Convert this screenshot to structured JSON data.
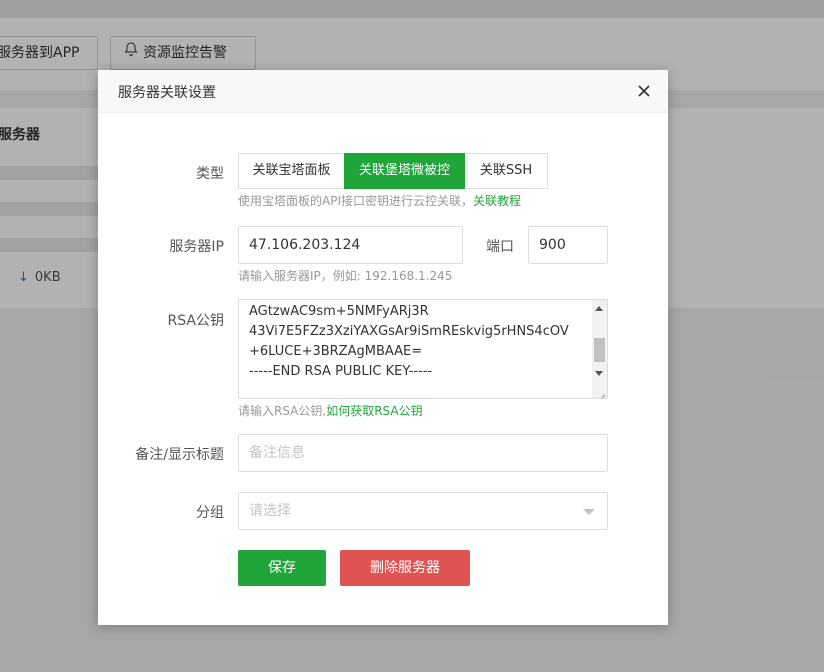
{
  "background": {
    "toolbar": {
      "button_1": "服务器到APP",
      "button_2": "资源监控告警"
    },
    "panel_title": "服务器",
    "traffic": "0KB"
  },
  "modal": {
    "title": "服务器关联设置",
    "type": {
      "label": "类型",
      "options": [
        "关联宝塔面板",
        "关联堡塔微被控",
        "关联SSH"
      ],
      "selected": "关联堡塔微被控",
      "hint": "使用宝塔面板的API接口密钥进行云控关联，",
      "hint_link": "关联教程"
    },
    "server_ip": {
      "label": "服务器IP",
      "value": "47.106.203.124",
      "hint": "请输入服务器IP，例如: 192.168.1.245"
    },
    "port": {
      "label": "端口",
      "value": "900"
    },
    "rsa": {
      "label": "RSA公钥",
      "lines": [
        "AGtzwAC9sm+5NMFyARj3R",
        "43Vi7E5FZz3XziYAXGsAr9iSmREskvig5rHNS4cOV",
        "+6LUCE+3BRZAgMBAAE=",
        "-----END RSA PUBLIC KEY-----"
      ],
      "hint": "请输入RSA公钥,",
      "hint_link": "如何获取RSA公钥"
    },
    "remark": {
      "label": "备注/显示标题",
      "placeholder": "备注信息"
    },
    "group": {
      "label": "分组",
      "placeholder": "请选择"
    },
    "buttons": {
      "save": "保存",
      "delete": "删除服务器"
    }
  },
  "colors": {
    "primary": "#20a53a",
    "danger": "#e05353",
    "overlay": "rgba(0,0,0,0.30)"
  }
}
